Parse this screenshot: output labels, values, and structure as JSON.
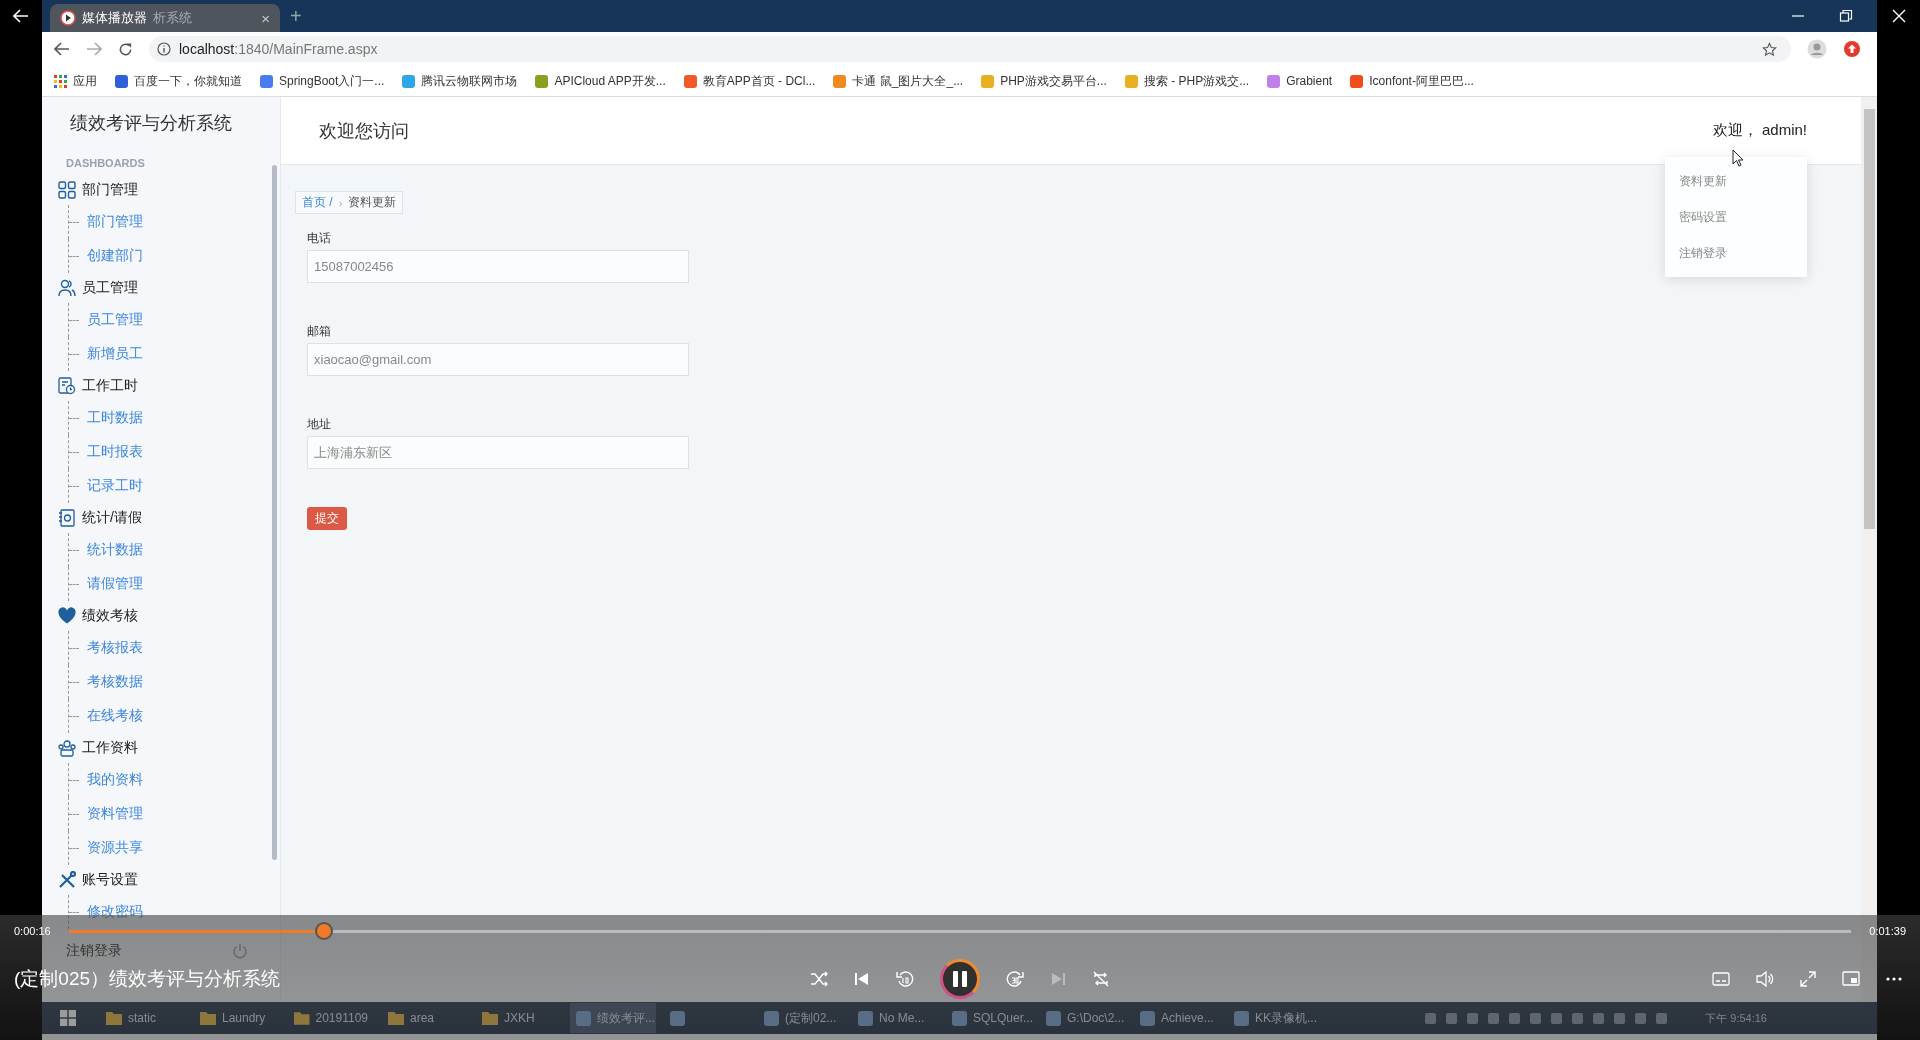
{
  "player": {
    "playing": true,
    "elapsed": "0:00:16",
    "duration": "0:01:39",
    "level": 0.143,
    "title": "(定制025）绩效考评与分析系统"
  },
  "browser": {
    "tab": {
      "title": "媒体播放器",
      "title_rest": "析系统",
      "close": "×"
    },
    "new_tab": "+",
    "url_host": "localhost",
    "url_path": ":1840/MainFrame.aspx",
    "bookmarks": [
      {
        "kind": "apps",
        "label": "应用"
      },
      {
        "kind": "site",
        "label": "百度一下，你就知道",
        "color": "#3060d8"
      },
      {
        "kind": "site",
        "label": "SpringBoot入门一...",
        "color": "#4a7cf0"
      },
      {
        "kind": "site",
        "label": "腾讯云物联网市场",
        "color": "#2fa6e8"
      },
      {
        "kind": "site",
        "label": "APICloud APP开发...",
        "color": "#8aa020"
      },
      {
        "kind": "site",
        "label": "教育APP首页 - DCl...",
        "color": "#f05a28"
      },
      {
        "kind": "site",
        "label": "卡通 鼠_图片大全_...",
        "color": "#f08a20"
      },
      {
        "kind": "site",
        "label": "PHP游戏交易平台...",
        "color": "#e8b020"
      },
      {
        "kind": "site",
        "label": "搜索 - PHP游戏交...",
        "color": "#e8b020"
      },
      {
        "kind": "site",
        "label": "Grabient",
        "color": "#c080e8"
      },
      {
        "kind": "site",
        "label": "Iconfont-阿里巴巴...",
        "color": "#f04c1c"
      }
    ]
  },
  "app": {
    "brand": "绩效考评与分析系统",
    "section": "DASHBOARDS",
    "menu": [
      {
        "kind": "grid",
        "title": "部门管理",
        "children": [
          {
            "label": "部门管理"
          },
          {
            "label": "创建部门"
          }
        ]
      },
      {
        "kind": "users",
        "title": "员工管理",
        "children": [
          {
            "label": "员工管理"
          },
          {
            "label": "新增员工"
          }
        ]
      },
      {
        "kind": "sheet",
        "title": "工作工时",
        "children": [
          {
            "label": "工时数据"
          },
          {
            "label": "工时报表"
          },
          {
            "label": "记录工时"
          }
        ]
      },
      {
        "kind": "notebook",
        "title": "统计/请假",
        "children": [
          {
            "label": "统计数据"
          },
          {
            "label": "请假管理"
          }
        ]
      },
      {
        "kind": "heart",
        "title": "绩效考核",
        "children": [
          {
            "label": "考核报表"
          },
          {
            "label": "考核数据"
          },
          {
            "label": "在线考核"
          }
        ]
      },
      {
        "kind": "team",
        "title": "工作资料",
        "children": [
          {
            "label": "我的资料"
          },
          {
            "label": "资料管理"
          },
          {
            "label": "资源共享"
          }
        ]
      },
      {
        "kind": "tools",
        "title": "账号设置",
        "children": [
          {
            "label": "修改密码"
          }
        ]
      }
    ],
    "logout": "注销登录",
    "header_title": "欢迎您访问",
    "greeting": "欢迎， admin!",
    "user_menu": [
      "资料更新",
      "密码设置",
      "注销登录"
    ],
    "breadcrumb": {
      "home": "首页 /",
      "separator": "›",
      "current": "资料更新"
    },
    "form": {
      "fields": [
        {
          "label": "电话",
          "placeholder": "15087002456"
        },
        {
          "label": "邮箱",
          "placeholder": "xiaocao@gmail.com"
        },
        {
          "label": "地址",
          "placeholder": "上海浦东新区"
        }
      ],
      "submit": "提交"
    }
  },
  "taskbar": {
    "items": [
      {
        "kind": "folder",
        "label": "static",
        "selected": false
      },
      {
        "kind": "folder",
        "label": "Laundry",
        "selected": false
      },
      {
        "kind": "folder",
        "label": "20191109",
        "selected": false
      },
      {
        "kind": "folder",
        "label": "area",
        "selected": false
      },
      {
        "kind": "folder",
        "label": "JXKH",
        "selected": false
      },
      {
        "kind": "app",
        "label": "绩效考评...",
        "selected": true
      },
      {
        "kind": "app",
        "selected": false
      },
      {
        "kind": "app",
        "label": "(定制02...",
        "selected": false
      },
      {
        "kind": "app",
        "label": "No Me...",
        "selected": false
      },
      {
        "kind": "app",
        "label": "SQLQuer...",
        "selected": false
      },
      {
        "kind": "app",
        "label": "G:\\Doc\\2...",
        "selected": false
      },
      {
        "kind": "app",
        "label": "Achieve...",
        "selected": false
      },
      {
        "kind": "app",
        "label": "KK录像机...",
        "selected": false
      }
    ],
    "clock": "下午 9:54:16"
  }
}
